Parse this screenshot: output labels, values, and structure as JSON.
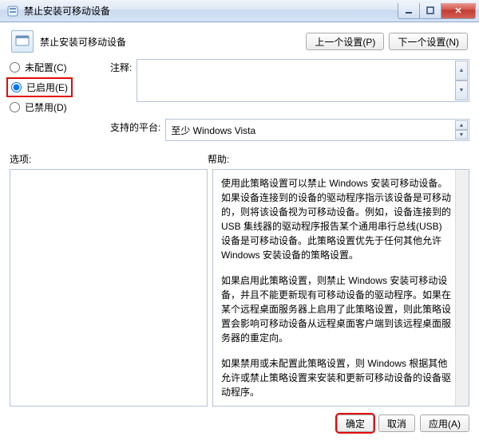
{
  "window": {
    "title": "禁止安装可移动设备"
  },
  "header": {
    "policy_name": "禁止安装可移动设备",
    "prev_setting": "上一个设置(P)",
    "next_setting": "下一个设置(N)"
  },
  "config": {
    "not_configured": "未配置(C)",
    "enabled": "已启用(E)",
    "disabled": "已禁用(D)",
    "selected": "enabled",
    "comment_label": "注释:",
    "comment_value": "",
    "platform_label": "支持的平台:",
    "platform_value": "至少 Windows Vista"
  },
  "mid": {
    "options_label": "选项:",
    "help_label": "帮助:"
  },
  "help": {
    "p1": "使用此策略设置可以禁止 Windows 安装可移动设备。如果设备连接到的设备的驱动程序指示该设备是可移动的，则将该设备视为可移动设备。例如，设备连接到的 USB 集线器的驱动程序报告某个通用串行总线(USB)设备是可移动设备。此策略设置优先于任何其他允许 Windows 安装设备的策略设置。",
    "p2": "如果启用此策略设置，则禁止 Windows 安装可移动设备，并且不能更新现有可移动设备的驱动程序。如果在某个远程桌面服务器上启用了此策略设置，则此策略设置会影响可移动设备从远程桌面客户端到该远程桌面服务器的重定向。",
    "p3": "如果禁用或未配置此策略设置，则 Windows 根据其他允许或禁止策略设置来安装和更新可移动设备的设备驱动程序。"
  },
  "footer": {
    "ok": "确定",
    "cancel": "取消",
    "apply": "应用(A)"
  }
}
